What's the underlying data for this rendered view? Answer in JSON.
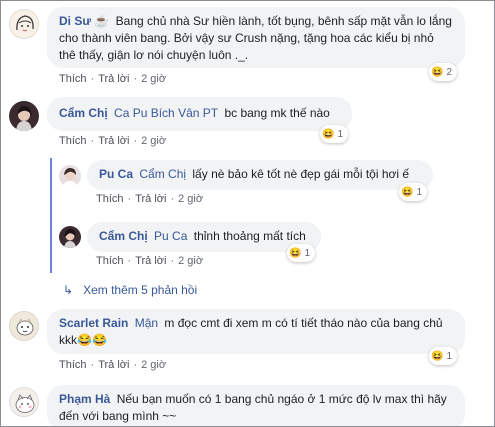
{
  "comments": [
    {
      "name": "Di Sư ☕",
      "text": "Bang chủ nhà Sư hiền lành, tốt bụng, bênh sấp mặt vẫn lo lắng cho thành viên bang. Bởi vậy sư Crush nặng, tặng hoa các kiểu bị nhỏ thê thấy, giận lơ nói chuyện luôn ._.",
      "like": "Thích",
      "reply": "Trả lời",
      "time": "2 giờ",
      "reaction_count": "2"
    },
    {
      "name": "Cẩm Chị",
      "tag": "Ca Pu Bích Vân PT",
      "text": "bc bang mk thế nào",
      "like": "Thích",
      "reply": "Trả lời",
      "time": "2 giờ",
      "reaction_count": "1"
    },
    {
      "name": "Pu Ca",
      "tag": "Cẩm Chị",
      "text": "lấy nè bảo kê tốt nè đẹp gái mỗi tội hơi ế",
      "like": "Thích",
      "reply": "Trả lời",
      "time": "2 giờ",
      "reaction_count": "1"
    },
    {
      "name": "Cẩm Chị",
      "tag": "Pu Ca",
      "text": "thỉnh thoảng mất tích",
      "like": "Thích",
      "reply": "Trả lời",
      "time": "2 giờ",
      "reaction_count": "1"
    },
    {
      "name": "Scarlet Rain",
      "tag": "Mận",
      "text": "m đọc cmt đi xem m có tí tiết tháo nào của bang chủ kkk😂😂",
      "like": "Thích",
      "reply": "Trả lời",
      "time": "2 giờ",
      "reaction_count": "1"
    },
    {
      "name": "Phạm Hà",
      "text": "Nếu bạn muốn có 1 bang chủ ngáo ở 1 mức độ lv max thì hãy đến với bang mình ~~"
    }
  ],
  "more_replies": "Xem thêm 5 phản hồi",
  "reaction_icon": "laughing-emoji-icon",
  "colors": {
    "link": "#385898",
    "bubble": "#f2f3f5",
    "thread_line": "#6b85d9"
  }
}
